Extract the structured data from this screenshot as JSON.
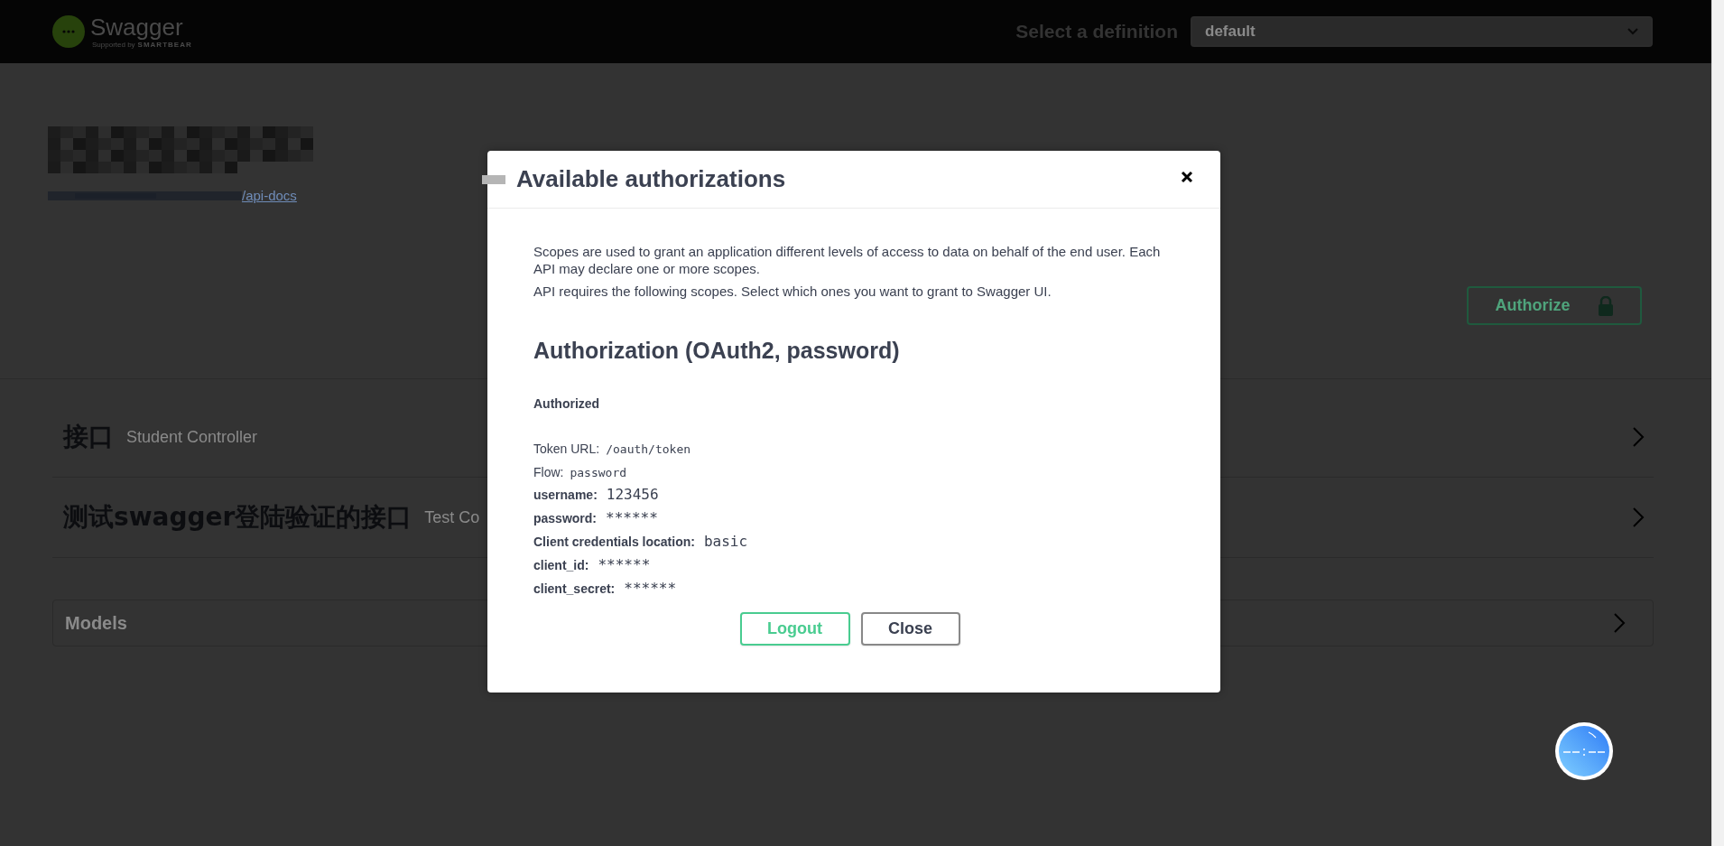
{
  "topbar": {
    "brand": "Swagger",
    "tagline_prefix": "Supported by",
    "tagline_brand": "SMARTBEAR",
    "definition_label": "Select a definition",
    "definition_value": "default"
  },
  "info": {
    "link": "/api-docs"
  },
  "authorize_button": {
    "label": "Authorize"
  },
  "tags": [
    {
      "name": "接口",
      "description": "Student Controller"
    },
    {
      "name": "测试swagger登陆验证的接口",
      "description": "Test Co"
    }
  ],
  "models": {
    "title": "Models"
  },
  "dialog": {
    "title": "Available authorizations",
    "description": [
      "Scopes are used to grant an application different levels of access to data on behalf of the end user. Each API may declare one or more scopes.",
      "API requires the following scopes. Select which ones you want to grant to Swagger UI."
    ],
    "scheme_title": "Authorization (OAuth2, password)",
    "status": "Authorized",
    "flow_info": [
      {
        "label": "Token URL:",
        "value": "/oauth/token"
      },
      {
        "label": "Flow:",
        "value": "password"
      }
    ],
    "fields": [
      {
        "label": "username:",
        "value": "123456"
      },
      {
        "label": "password:",
        "value": "******"
      },
      {
        "label": "Client credentials location:",
        "value": "basic"
      },
      {
        "label": "client_id:",
        "value": "******"
      },
      {
        "label": "client_secret:",
        "value": "******"
      }
    ],
    "buttons": [
      {
        "label": "Logout",
        "kind": "logout"
      },
      {
        "label": "Close",
        "kind": "close"
      }
    ]
  }
}
